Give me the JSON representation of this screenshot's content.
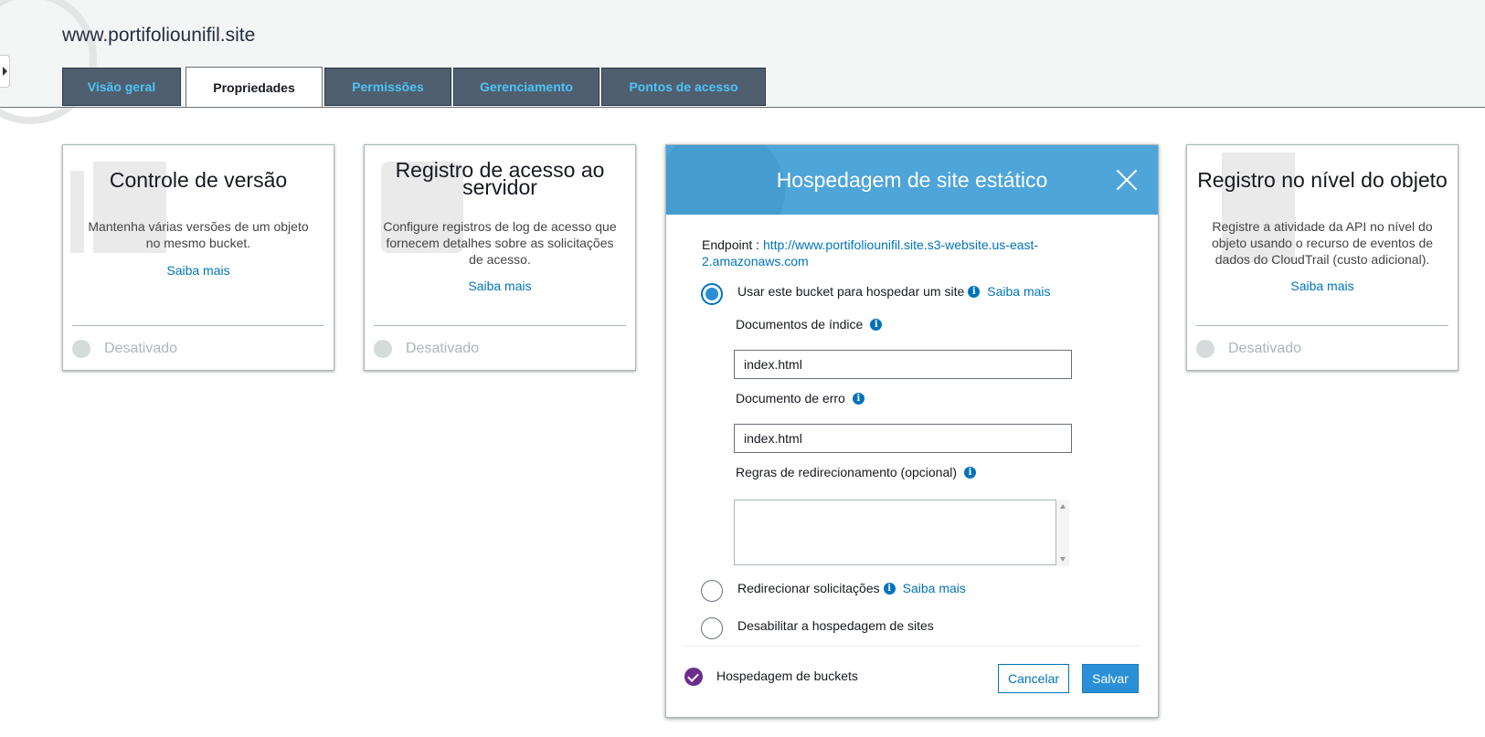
{
  "bucket": {
    "name": "www.portifoliounifil.site"
  },
  "tabs": [
    {
      "label": "Visão geral"
    },
    {
      "label": "Propriedades"
    },
    {
      "label": "Permissões"
    },
    {
      "label": "Gerenciamento"
    },
    {
      "label": "Pontos de acesso"
    }
  ],
  "active_tab": "Propriedades",
  "cards": {
    "versioning": {
      "title": "Controle de versão",
      "description": "Mantenha várias versões de um objeto no mesmo bucket.",
      "link": "Saiba mais",
      "status": "Desativado"
    },
    "access_logging": {
      "title": "Registro de acesso ao servidor",
      "description": "Configure registros de log de acesso que fornecem detalhes sobre as solicitações de acesso.",
      "link": "Saiba mais",
      "status": "Desativado"
    },
    "object_logging": {
      "title": "Registro no nível do objeto",
      "description": "Registre a atividade da API no nível do objeto usando o recurso de eventos de dados do CloudTrail (custo adicional).",
      "link": "Saiba mais",
      "status": "Desativado"
    }
  },
  "static_hosting": {
    "title": "Hospedagem de site estático",
    "endpoint_label": "Endpoint :",
    "endpoint_url": "http://www.portifoliounifil.site.s3-website.us-east-2.amazonaws.com",
    "options": {
      "use_bucket": {
        "label": "Usar este bucket para hospedar um site",
        "link": "Saiba mais",
        "selected": true
      },
      "redirect": {
        "label": "Redirecionar solicitações",
        "link": "Saiba mais",
        "selected": false
      },
      "disable": {
        "label": "Desabilitar a hospedagem de sites",
        "selected": false
      }
    },
    "index_document": {
      "label": "Documentos de índice",
      "value": "index.html"
    },
    "error_document": {
      "label": "Documento de erro",
      "value": "index.html"
    },
    "redirect_rules": {
      "label": "Regras de redirecionamento (opcional)",
      "value": ""
    },
    "footer": {
      "status_label": "Hospedagem de buckets",
      "cancel": "Cancelar",
      "save": "Salvar"
    }
  },
  "colors": {
    "tab_bg": "#4f5f6f",
    "tab_text": "#4fc3f7",
    "modal_header": "#4ea5d9",
    "link": "#0073bb",
    "primary_button": "#2a8fd6",
    "enabled_check": "#6b2d8c"
  },
  "icons": {
    "info": "info-icon",
    "close": "close-icon",
    "check": "check-icon",
    "sidebar_toggle": "caret-right-icon"
  }
}
